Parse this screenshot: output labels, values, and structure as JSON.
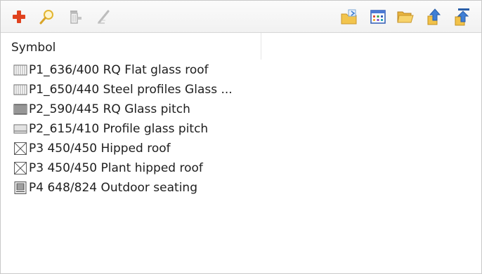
{
  "toolbar": {
    "left_buttons": [
      {
        "name": "add-icon"
      },
      {
        "name": "search-icon"
      },
      {
        "name": "delete-icon"
      },
      {
        "name": "edit-icon"
      }
    ],
    "right_buttons": [
      {
        "name": "import-icon"
      },
      {
        "name": "catalog-grid-icon"
      },
      {
        "name": "open-folder-icon"
      },
      {
        "name": "move-up-icon"
      },
      {
        "name": "move-top-icon"
      }
    ]
  },
  "list": {
    "column_header": "Symbol",
    "rows": [
      {
        "symbol": "glass-roof-hatch-icon",
        "label": "P1_636/400 RQ Flat glass roof"
      },
      {
        "symbol": "glass-roof-hatch-icon",
        "label": "P1_650/440 Steel profiles Glass ..."
      },
      {
        "symbol": "dense-hatch-icon",
        "label": "P2_590/445 RQ Glass pitch"
      },
      {
        "symbol": "profile-glass-icon",
        "label": "P2_615/410 Profile glass pitch"
      },
      {
        "symbol": "hipped-roof-icon",
        "label": "P3 450/450 Hipped roof"
      },
      {
        "symbol": "hipped-roof-icon",
        "label": "P3 450/450 Plant hipped roof"
      },
      {
        "symbol": "outdoor-seating-icon",
        "label": "P4 648/824 Outdoor seating"
      }
    ]
  }
}
